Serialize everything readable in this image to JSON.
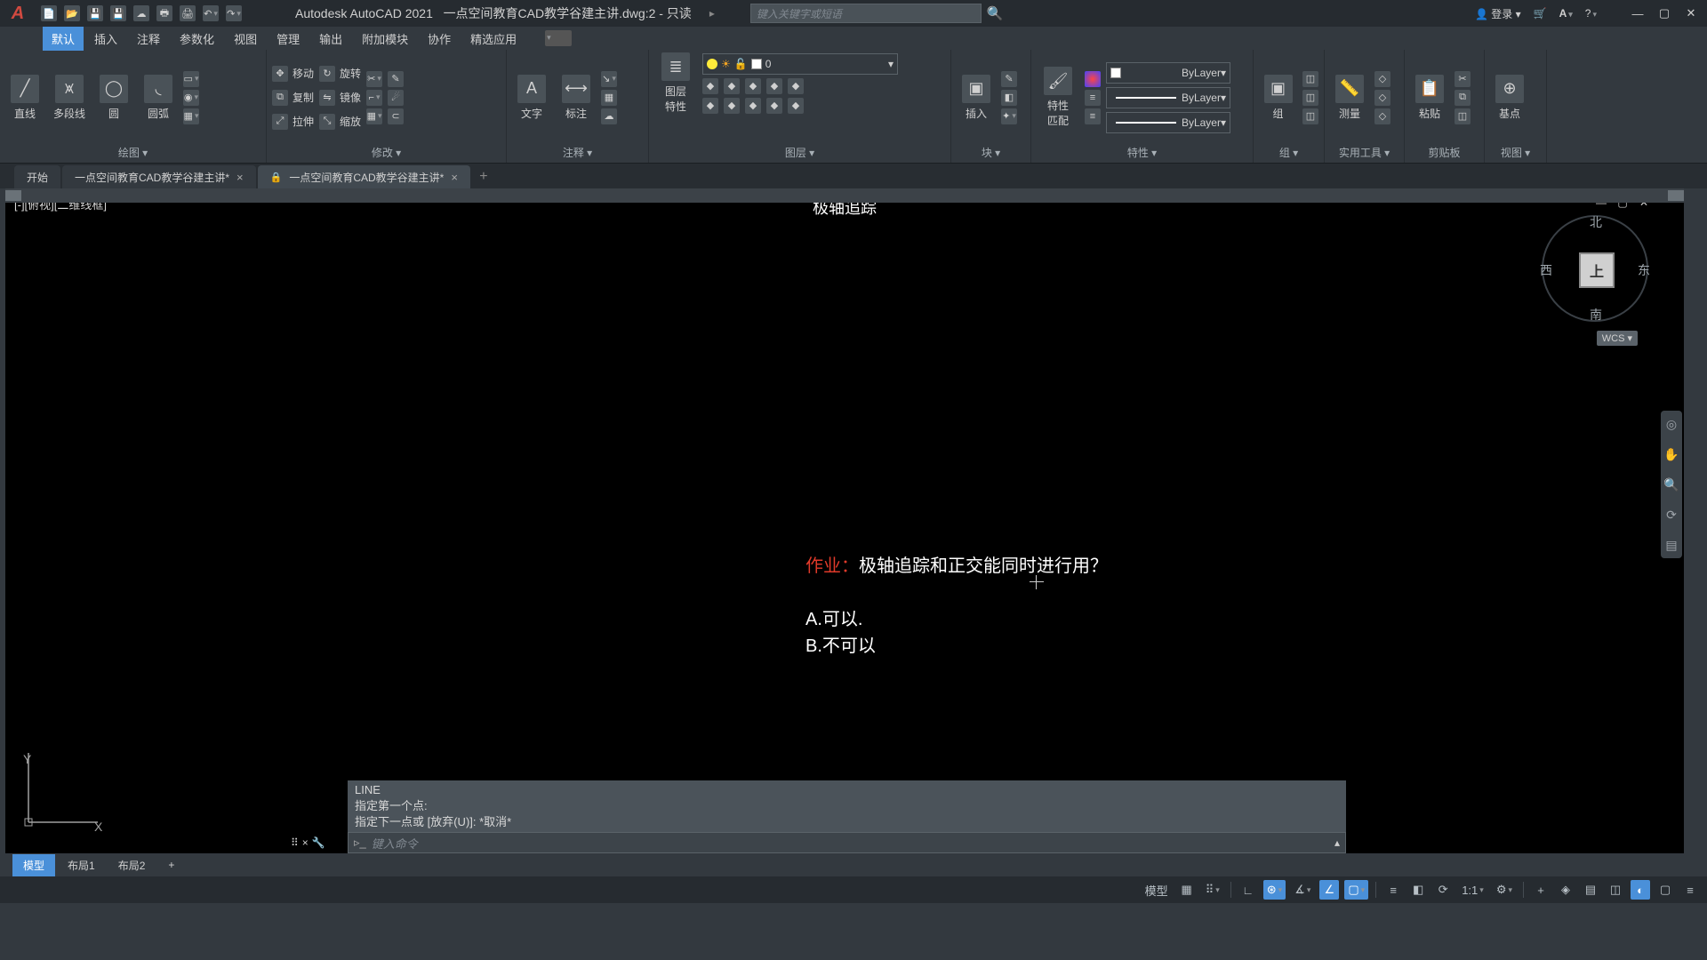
{
  "app": {
    "name": "Autodesk AutoCAD 2021",
    "doc": "一点空间教育CAD教学谷建主讲.dwg:2 - 只读"
  },
  "search": {
    "placeholder": "键入关键字或短语"
  },
  "login": "登录",
  "menu": [
    "默认",
    "插入",
    "注释",
    "参数化",
    "视图",
    "管理",
    "输出",
    "附加模块",
    "协作",
    "精选应用"
  ],
  "ribbon": {
    "draw": {
      "title": "绘图 ▾",
      "line": "直线",
      "pline": "多段线",
      "circle": "圆",
      "arc": "圆弧"
    },
    "modify": {
      "title": "修改 ▾",
      "move": "移动",
      "rotate": "旋转",
      "copy": "复制",
      "mirror": "镜像",
      "stretch": "拉伸",
      "scale": "缩放"
    },
    "annot": {
      "title": "注释 ▾",
      "text": "文字",
      "dim": "标注"
    },
    "layer": {
      "title": "图层 ▾",
      "btn": "图层\n特性",
      "current": "0"
    },
    "block": {
      "title": "块 ▾",
      "insert": "插入"
    },
    "prop": {
      "title": "特性 ▾",
      "match": "特性\n匹配",
      "bylayer": "ByLayer"
    },
    "group": {
      "title": "组 ▾",
      "btn": "组"
    },
    "util": {
      "title": "实用工具 ▾",
      "measure": "测量"
    },
    "clip": {
      "title": "剪贴板",
      "paste": "粘贴"
    },
    "base": {
      "btn": "基点"
    },
    "view": {
      "title": "视图 ▾"
    }
  },
  "tabs": {
    "start": "开始",
    "t1": "一点空间教育CAD教学谷建主讲*",
    "t2": "一点空间教育CAD教学谷建主讲*"
  },
  "viewctrl": "[-][俯视][二维线框]",
  "canvas": {
    "topline": "极轴追踪",
    "hw_label": "作业：",
    "hw_q": "极轴追踪和正交能同时进行用？",
    "opt_a": "A.可以.",
    "opt_b": "B.不可以"
  },
  "viewcube": {
    "n": "北",
    "s": "南",
    "e": "东",
    "w": "西",
    "top": "上",
    "wcs": "WCS ▾"
  },
  "cmd": {
    "h1": "LINE",
    "h2": "指定第一个点:",
    "h3": "指定下一点或 [放弃(U)]: *取消*",
    "prompt": "键入命令"
  },
  "layouts": {
    "model": "模型",
    "l1": "布局1",
    "l2": "布局2"
  },
  "status": {
    "model": "模型",
    "scale": "1:1"
  }
}
